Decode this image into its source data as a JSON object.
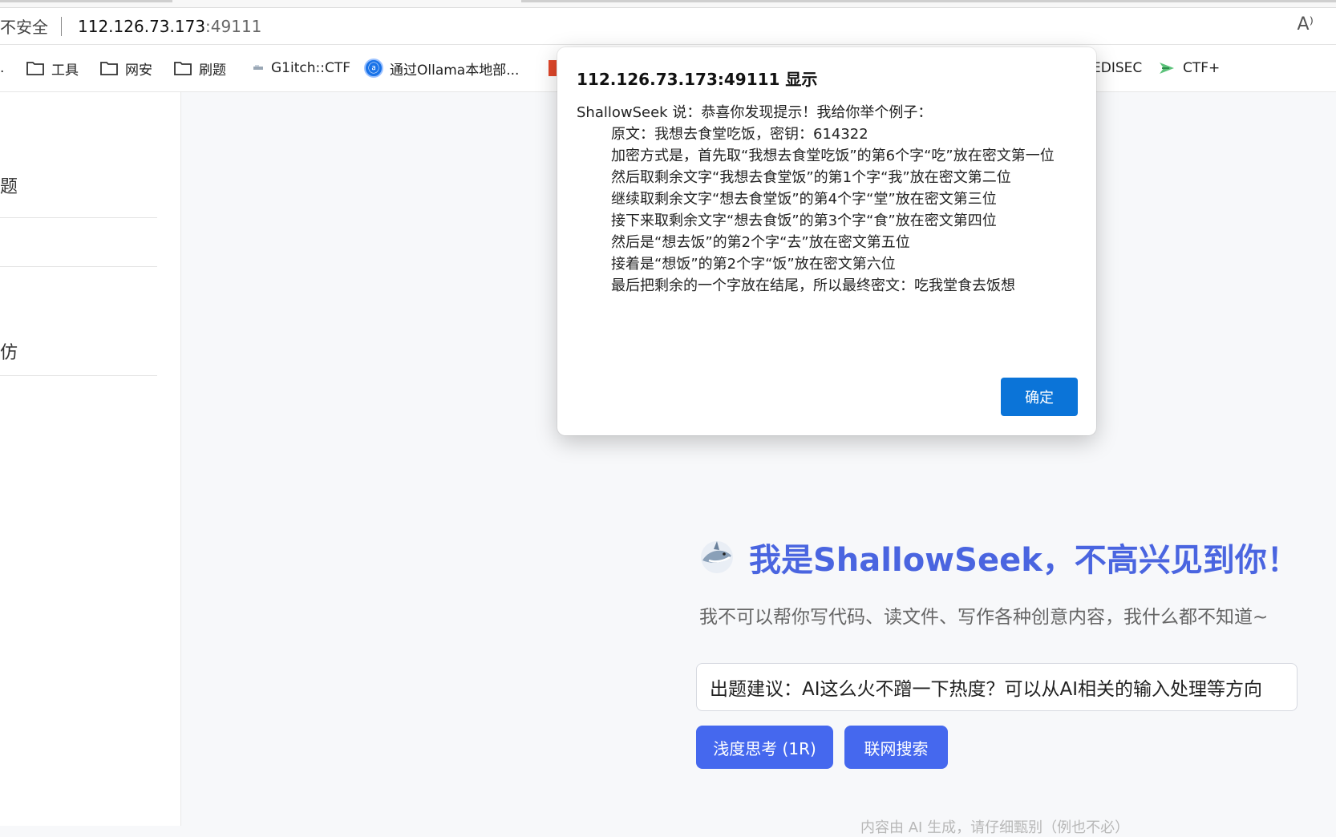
{
  "browser": {
    "insecure_label": "不安全",
    "url_host": "112.126.73.173",
    "url_port": ":49111",
    "read_aloud_icon": "A⁾"
  },
  "bookmarks": {
    "ellipsis": ".",
    "items": [
      {
        "label": "工具",
        "icon": "folder-icon"
      },
      {
        "label": "网安",
        "icon": "folder-icon"
      },
      {
        "label": "刷题",
        "icon": "folder-icon"
      },
      {
        "label": "G1itch::CTF",
        "icon": "g1itch-icon"
      },
      {
        "label": "通过Ollama本地部...",
        "icon": "ollama-icon"
      },
      {
        "label": "EDISEC",
        "icon": "edisec-icon"
      },
      {
        "label": "CTF+",
        "icon": "ctf-plus-icon"
      }
    ]
  },
  "sidebar": {
    "items": [
      {
        "label": "题"
      },
      {
        "label": ""
      },
      {
        "label": "仿"
      }
    ]
  },
  "main": {
    "title": "我是ShallowSeek，不高兴见到你！",
    "subtitle": "我不可以帮你写代码、读文件、写作各种创意内容，我什么都不知道~",
    "prompt_value": "出题建议：AI这么火不蹭一下热度？可以从AI相关的输入处理等方向",
    "buttons": {
      "think": "浅度思考 (1R)",
      "search": "联网搜索"
    },
    "footer_note": "内容由 AI 生成，请仔细甄别（例也不必）"
  },
  "dialog": {
    "title": "112.126.73.173:49111 显示",
    "lines": [
      "ShallowSeek 说：恭喜你发现提示！我给你举个例子：",
      "原文：我想去食堂吃饭，密钥：614322",
      "加密方式是，首先取“我想去食堂吃饭”的第6个字“吃”放在密文第一位",
      "然后取剩余文字“我想去食堂饭”的第1个字“我”放在密文第二位",
      "继续取剩余文字“想去食堂饭”的第4个字“堂”放在密文第三位",
      "接下来取剩余文字“想去食饭”的第3个字“食”放在密文第四位",
      "然后是“想去饭”的第2个字“去”放在密文第五位",
      "接着是“想饭”的第2个字“饭”放在密文第六位",
      "最后把剩余的一个字放在结尾，所以最终密文：吃我堂食去饭想"
    ],
    "ok_label": "确定"
  }
}
